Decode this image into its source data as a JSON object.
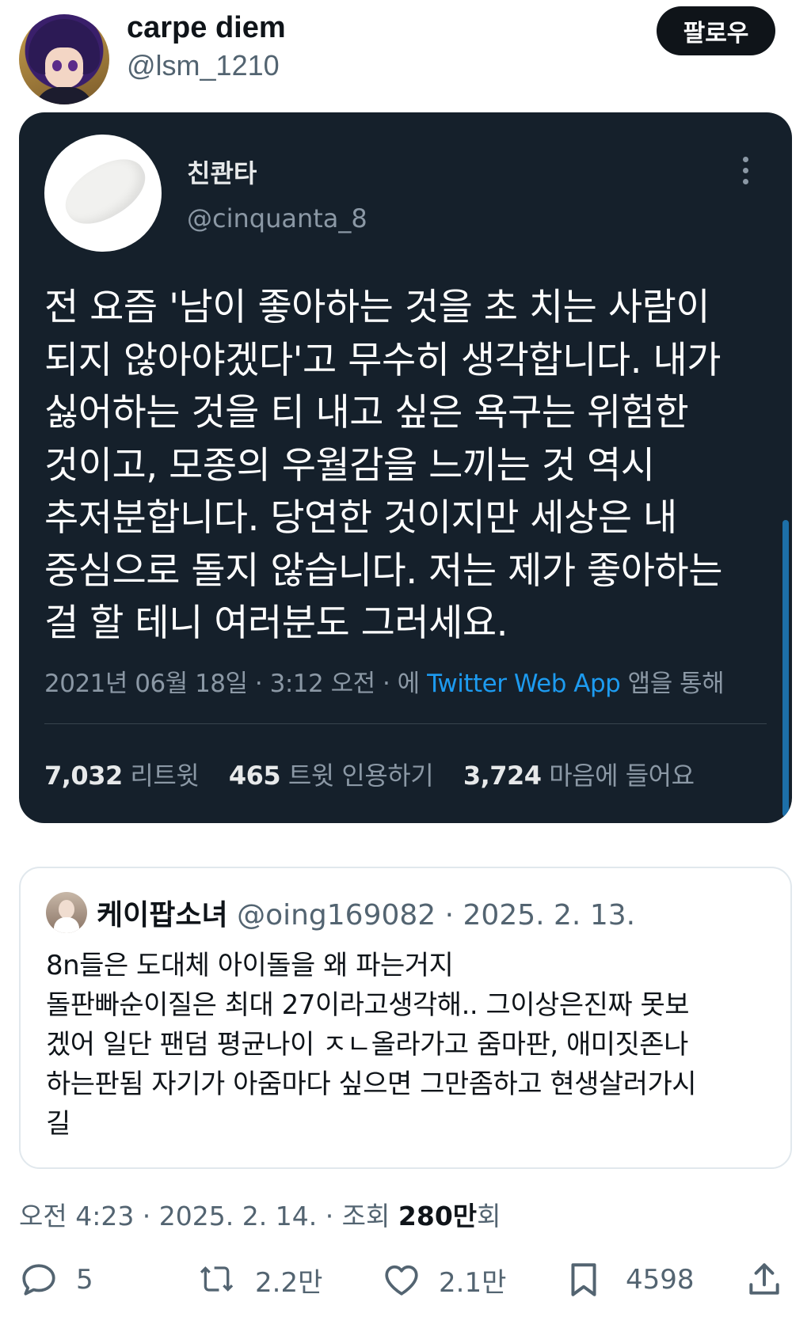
{
  "author": {
    "display_name": "carpe diem",
    "handle": "@lsm_1210",
    "follow_label": "팔로우"
  },
  "embedded_tweet": {
    "name": "친콴타",
    "handle": "@cinquanta_8",
    "text": "전 요즘 '남이 좋아하는 것을 초 치는 사람이\n되지 않아야겠다'고 무수히 생각합니다. 내가\n싫어하는 것을 티 내고 싶은 욕구는 위험한\n것이고, 모종의 우월감을 느끼는 것 역시\n추저분합니다. 당연한 것이지만 세상은 내\n중심으로 돌지 않습니다. 저는 제가 좋아하는\n걸 할 테니 여러분도 그러세요.",
    "meta_prefix": "2021년 06월 18일 · 3:12 오전 · 에 ",
    "meta_app": "Twitter Web App",
    "meta_suffix": " 앱을 통해",
    "retweets_count": "7,032",
    "retweets_label": "리트윗",
    "quotes_count": "465",
    "quotes_label": "트윗 인용하기",
    "likes_count": "3,724",
    "likes_label": "마음에 들어요"
  },
  "quoted_tweet": {
    "name": "케이팝소녀",
    "handle": "@oing169082",
    "date": "· 2025. 2. 13.",
    "text": "8n들은 도대체 아이돌을 왜 파는거지\n돌판빠순이질은 최대 27이라고생각해.. 그이상은진짜 못보\n겠어 일단 팬덤 평균나이 ㅈㄴ올라가고 줌마판, 애미짓존나\n하는판됨 자기가 아줌마다 싶으면 그만좀하고 현생살러가시\n길"
  },
  "timestamp": {
    "prefix": "오전 4:23 · 2025. 2. 14. · 조회 ",
    "views_number": "280만",
    "views_suffix": "회"
  },
  "actions": {
    "reply_count": "5",
    "retweet_count": "2.2만",
    "like_count": "2.1만",
    "bookmark_count": "4598",
    "icons": [
      "reply-icon",
      "retweet-icon",
      "heart-icon",
      "bookmark-icon",
      "share-icon"
    ]
  },
  "colors": {
    "embedded_bg": "#15202b",
    "link_blue": "#1d9bf0",
    "muted_text": "#536471"
  }
}
